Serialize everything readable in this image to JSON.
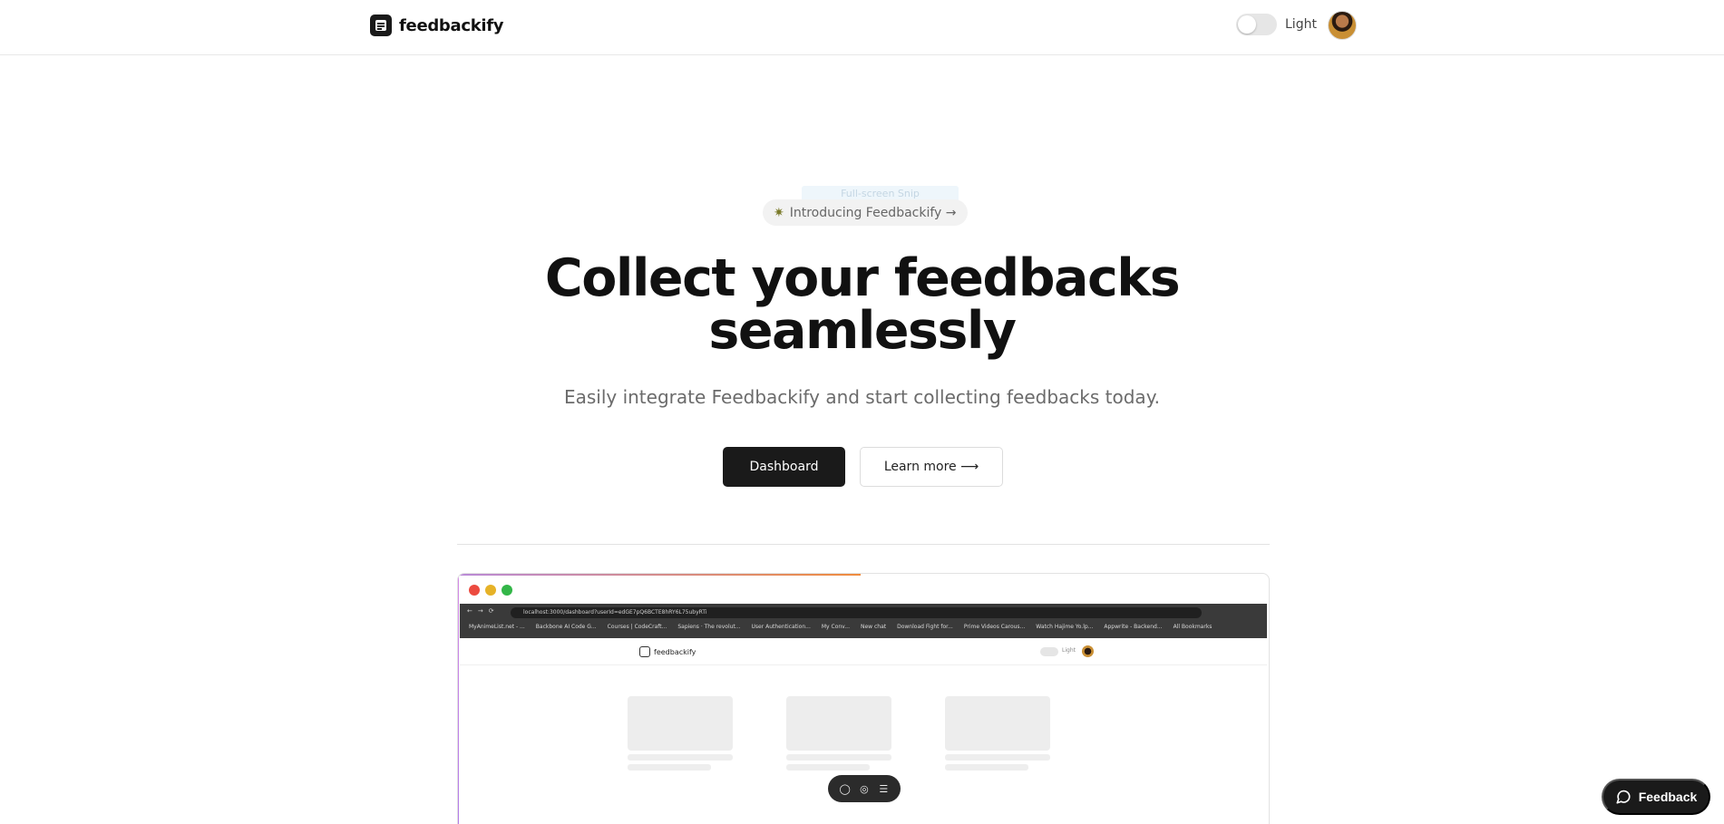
{
  "nav": {
    "brand": "feedbackify",
    "theme_label": "Light",
    "theme_on": false
  },
  "hero": {
    "ghost_tooltip": "Full-screen Snip",
    "badge": "Introducing Feedbackify →",
    "title_line1": "Collect your feedbacks",
    "title_line2": "seamlessly",
    "subtitle": "Easily integrate Feedbackify and start collecting feedbacks today.",
    "primary_cta": "Dashboard",
    "secondary_cta": "Learn more ⟶"
  },
  "preview": {
    "window_dots": [
      "#ec4a3f",
      "#e6b227",
      "#33b648"
    ],
    "url": "localhost:3000/dashboard?userId=edGE7pQ6BCTE8hRY6L75ubyRTi",
    "bookmarks": [
      "MyAnimeList.net - ...",
      "Backbone AI Code G...",
      "Courses | CodeCraft...",
      "Sapiens · The revolut...",
      "User Authentication...",
      "My Conv...",
      "New chat",
      "Download Fight for...",
      "Prime Videos Carous...",
      "Watch Hajime Yo.lp...",
      "Appwrite - Backend...",
      "All Bookmarks"
    ],
    "inner_brand": "feedbackify",
    "inner_theme_label": "Light"
  },
  "feedback_button": {
    "label": "Feedback"
  }
}
